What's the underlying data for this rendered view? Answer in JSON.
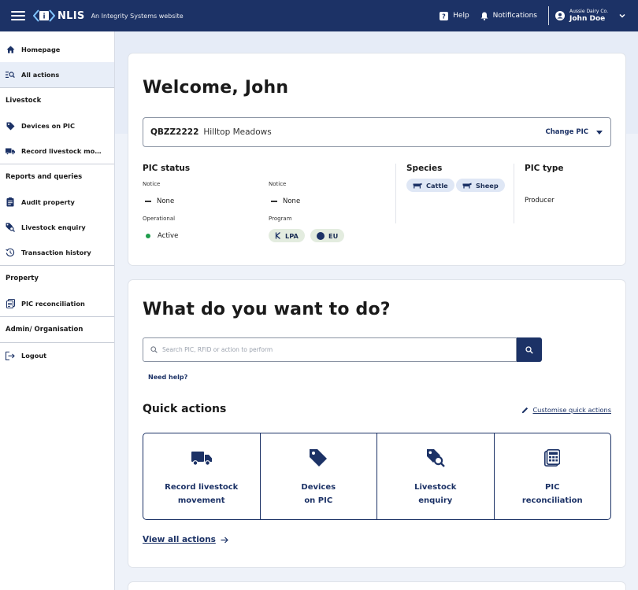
{
  "topbar": {
    "brand": "NLIS",
    "tagline": "An Integrity Systems website",
    "help_label": "Help",
    "notifications_label": "Notifications",
    "account_org": "Aussie Dairy Co.",
    "account_user": "John Doe"
  },
  "sidebar": {
    "items": [
      {
        "label": "Homepage",
        "icon": "home-icon"
      },
      {
        "label": "All actions",
        "icon": "list-search-icon"
      }
    ],
    "sections": [
      {
        "title": "Livestock",
        "items": [
          {
            "label": "Devices on PIC",
            "icon": "tag-icon"
          },
          {
            "label": "Record livestock movement",
            "icon": "truck-icon"
          }
        ]
      },
      {
        "title": "Reports and queries",
        "items": [
          {
            "label": "Audit property",
            "icon": "clipboard-icon"
          },
          {
            "label": "Livestock enquiry",
            "icon": "tag-search-icon"
          },
          {
            "label": "Transaction history",
            "icon": "history-icon"
          }
        ]
      },
      {
        "title": "Property",
        "items": [
          {
            "label": "PIC reconciliation",
            "icon": "document-stack-icon"
          }
        ]
      },
      {
        "title": "Admin/ Organisation",
        "items": []
      }
    ],
    "logout_label": "Logout"
  },
  "welcome": {
    "title": "Welcome, John",
    "pic_code": "QBZZ2222",
    "pic_name": "Hilltop Meadows",
    "change_pic_label": "Change PIC"
  },
  "pic_status": {
    "heading": "PIC status",
    "notice_label_1": "Notice",
    "notice_value_1": "None",
    "notice_label_2": "Notice",
    "notice_value_2": "None",
    "operational_label": "Operational",
    "operational_value": "Active",
    "program_label": "Program",
    "programs": [
      "LPA",
      "EU"
    ]
  },
  "species": {
    "heading": "Species",
    "items": [
      "Cattle",
      "Sheep"
    ]
  },
  "pic_type": {
    "heading": "PIC type",
    "value": "Producer"
  },
  "actions": {
    "title": "What do you want to do?",
    "search_placeholder": "Search PIC, RFID or action to perform",
    "need_help": "Need help?",
    "quick_actions_title": "Quick actions",
    "customise_label": "Customise quick actions",
    "tiles": [
      {
        "label": "Record livestock\nmovement",
        "icon": "truck-icon"
      },
      {
        "label": "Devices\non PIC",
        "icon": "tag-icon"
      },
      {
        "label": "Livestock\nenquiry",
        "icon": "tag-search-icon"
      },
      {
        "label": "PIC\nreconciliation",
        "icon": "calculator-icon"
      }
    ],
    "view_all_label": "View all actions"
  },
  "colors": {
    "brand_navy": "#1c3266",
    "status_active": "#1f9d4c",
    "page_bg": "#eef2f9"
  }
}
